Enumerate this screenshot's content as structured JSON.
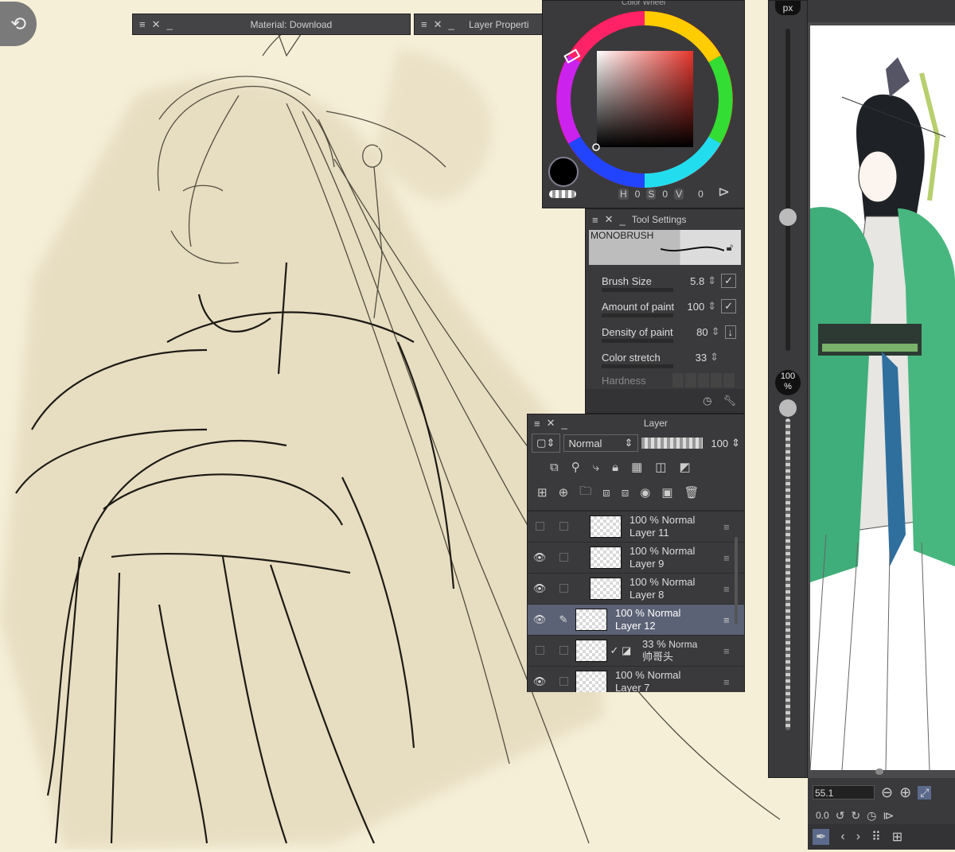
{
  "menu_title_windows": {
    "material": "Material: Download",
    "layer_property": "Layer Properti"
  },
  "color_wheel": {
    "title": "Color Wheel",
    "h_label": "H",
    "h_value": "0",
    "s_label": "S",
    "s_value": "0",
    "v_label": "V",
    "v_value": "0",
    "accent_color": "#e8362d"
  },
  "tool_settings": {
    "title": "Tool Settings",
    "brush_name": "MONOBRUSH",
    "params": [
      {
        "label": "Brush Size",
        "value": "5.8"
      },
      {
        "label": "Amount of paint",
        "value": "100"
      },
      {
        "label": "Density of paint",
        "value": "80"
      },
      {
        "label": "Color stretch",
        "value": "33"
      },
      {
        "label": "Hardness",
        "value": ""
      }
    ]
  },
  "layer_panel": {
    "title": "Layer",
    "blend_mode": "Normal",
    "opacity": "100",
    "layers": [
      {
        "opacity": "100 %",
        "mode": "Normal",
        "name": "Layer 11",
        "visible": false,
        "selected": false
      },
      {
        "opacity": "100 %",
        "mode": "Normal",
        "name": "Layer 9",
        "visible": true,
        "selected": false
      },
      {
        "opacity": "100 %",
        "mode": "Normal",
        "name": "Layer 8",
        "visible": true,
        "selected": false
      },
      {
        "opacity": "100 %",
        "mode": "Normal",
        "name": "Layer 12",
        "visible": true,
        "selected": true
      },
      {
        "opacity": "33 %",
        "mode": "Norma",
        "name": "帅哥头",
        "visible": false,
        "selected": false
      },
      {
        "opacity": "100 %",
        "mode": "Normal",
        "name": "Layer 7",
        "visible": true,
        "selected": false
      }
    ]
  },
  "side_slider": {
    "unit": "px",
    "opacity_label": "100",
    "opacity_unit": "%"
  },
  "navigator": {
    "zoom": "55.1",
    "rotation": "0.0"
  }
}
